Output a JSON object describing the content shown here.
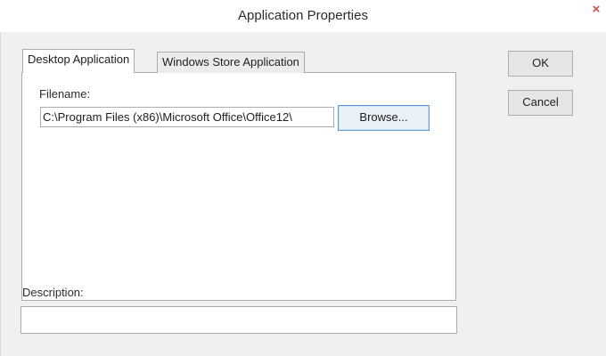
{
  "window": {
    "title": "Application Properties",
    "close_icon": "×"
  },
  "tabs": [
    {
      "label": "Desktop Application",
      "active": true
    },
    {
      "label": "Windows Store Application",
      "active": false
    }
  ],
  "filename": {
    "label": "Filename:",
    "value": "C:\\Program Files (x86)\\Microsoft Office\\Office12\\"
  },
  "buttons": {
    "browse": "Browse...",
    "ok": "OK",
    "cancel": "Cancel"
  },
  "description": {
    "label": "Description:",
    "value": ""
  },
  "colors": {
    "close_accent": "#c75050",
    "focus_border": "#5b9bd5"
  }
}
